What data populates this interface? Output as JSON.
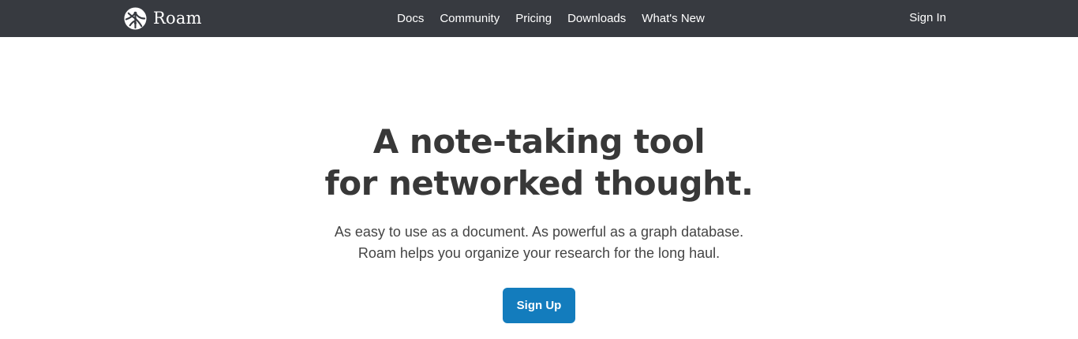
{
  "nav": {
    "brand": "Roam",
    "links": [
      "Docs",
      "Community",
      "Pricing",
      "Downloads",
      "What's New"
    ],
    "sign_in": "Sign In"
  },
  "hero": {
    "title_line1": "A note-taking tool",
    "title_line2": "for networked thought.",
    "subtitle_line1": "As easy to use as a document. As powerful as a graph database.",
    "subtitle_line2": "Roam helps you organize your research for the long haul.",
    "cta": "Sign Up"
  },
  "colors": {
    "navbar_bg": "#373a40",
    "cta_bg": "#137cbd",
    "title_text": "#383838"
  },
  "icons": {
    "brand_logo": "roam-logo-icon"
  }
}
